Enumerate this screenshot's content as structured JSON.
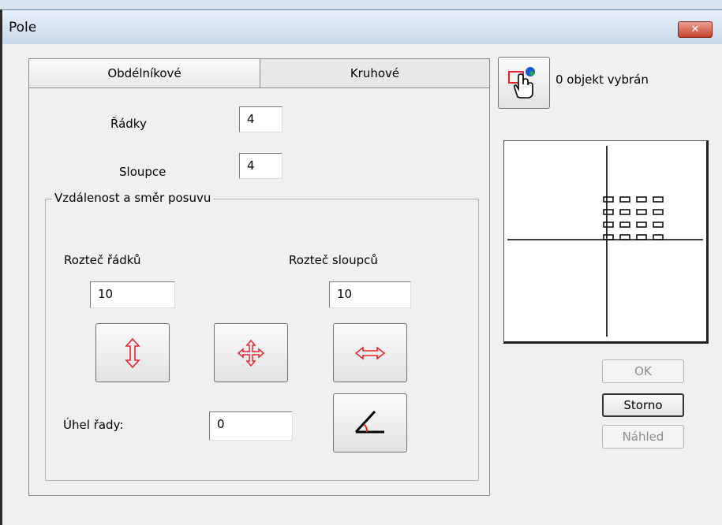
{
  "window": {
    "title": "Pole",
    "close_label": "✕"
  },
  "tabs": [
    {
      "label": "Obdélníkové",
      "active": true
    },
    {
      "label": "Kruhové",
      "active": false
    }
  ],
  "rows": {
    "label": "Řádky",
    "value": "4"
  },
  "columns": {
    "label": "Sloupce",
    "value": "4"
  },
  "offset_group": {
    "legend": "Vzdálenost a směr posuvu",
    "row_spacing": {
      "label": "Rozteč řádků",
      "value": "10"
    },
    "column_spacing": {
      "label": "Rozteč sloupců",
      "value": "10"
    },
    "angle": {
      "label": "Úhel řady:",
      "value": "0"
    }
  },
  "selection": {
    "status": "0 objekt vybrán"
  },
  "buttons": {
    "ok": "OK",
    "cancel": "Storno",
    "preview": "Náhled"
  },
  "colors": {
    "accent_red": "#e8262b",
    "titlebar": "#c9d9ec",
    "close_red": "#c6452a"
  },
  "preview_grid": {
    "rows": 4,
    "columns": 4
  }
}
